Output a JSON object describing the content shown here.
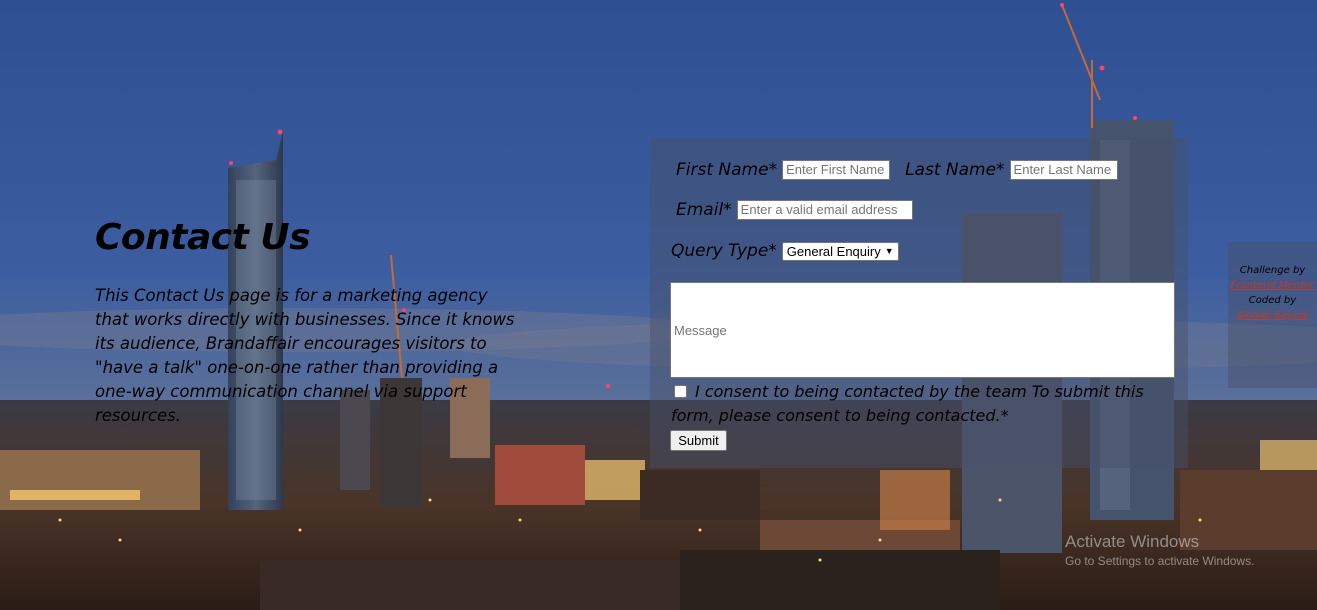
{
  "intro": {
    "title": "Contact Us",
    "description": "This Contact Us page is for a marketing agency that works directly with businesses. Since it knows its audience, Brandaffair encourages visitors to \"have a talk\" one-on-one rather than providing a one-way communication channel via support resources."
  },
  "form": {
    "first_name_label": "First Name*",
    "first_name_placeholder": "Enter First Name",
    "last_name_label": "Last Name*",
    "last_name_placeholder": "Enter Last Name",
    "email_label": "Email*",
    "email_placeholder": "Enter a valid email address",
    "query_type_label": "Query Type*",
    "query_type_selected": "General Enquiry",
    "message_placeholder": "Message",
    "consent_text": "I consent to being contacted by the team To submit this form, please consent to being contacted.*",
    "submit_label": "Submit"
  },
  "attribution": {
    "line1": "Challenge by",
    "link1": "Frontend Mentor",
    "line2": "Coded by",
    "link2": "Akinde Bayow",
    "link_color": "#c0392b"
  },
  "watermark": {
    "title": "Activate Windows",
    "subtitle": "Go to Settings to activate Windows."
  },
  "icons": {
    "select_chevron": "chevron-down-icon",
    "checkbox": "checkbox-icon"
  }
}
